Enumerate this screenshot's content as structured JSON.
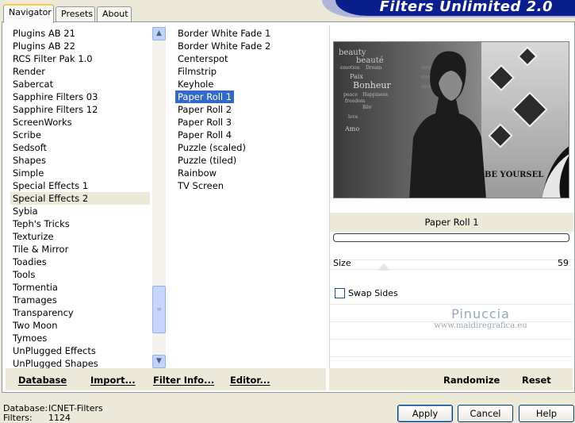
{
  "tabs": [
    {
      "label": "Navigator",
      "active": true
    },
    {
      "label": "Presets",
      "active": false
    },
    {
      "label": "About",
      "active": false
    }
  ],
  "banner": {
    "title": "Filters Unlimited 2.0"
  },
  "categories": {
    "items": [
      "Plugins AB 21",
      "Plugins AB 22",
      "RCS Filter Pak 1.0",
      "Render",
      "Sabercat",
      "Sapphire Filters 03",
      "Sapphire Filters 12",
      "ScreenWorks",
      "Scribe",
      "Sedsoft",
      "Shapes",
      "Simple",
      "Special Effects 1",
      "Special Effects 2",
      "Sybia",
      "Teph's Tricks",
      "Texturize",
      "Tile & Mirror",
      "Toadies",
      "Tools",
      "Tormentia",
      "Tramages",
      "Transparency",
      "Two Moon",
      "Tymoes",
      "UnPlugged Effects",
      "UnPlugged Shapes"
    ],
    "selected": "Special Effects 2"
  },
  "filters": {
    "items": [
      "Border White Fade 1",
      "Border White Fade 2",
      "Centerspot",
      "Filmstrip",
      "Keyhole",
      "Paper Roll 1",
      "Paper Roll 2",
      "Paper Roll 3",
      "Paper Roll 4",
      "Puzzle (scaled)",
      "Puzzle (tiled)",
      "Rainbow",
      "TV Screen"
    ],
    "selected": "Paper Roll 1"
  },
  "preview": {
    "overlay_words": [
      "beauty",
      "beauté",
      "emotion",
      "Dream",
      "Paix",
      "Bonheur",
      "peace",
      "Happiness",
      "freedom",
      "Rêv",
      "love",
      "Amo"
    ],
    "caption": "BE YOURSEL"
  },
  "filter_panel": {
    "title": "Paper Roll 1",
    "params": [
      {
        "label": "Size",
        "value": "59"
      }
    ],
    "checkbox": {
      "label": "Swap Sides",
      "checked": false
    },
    "watermark": {
      "name": "Pinuccia",
      "url": "www.maidiregrafica.eu"
    }
  },
  "left_footer": {
    "database": "Database",
    "import": "Import...",
    "filter_info": "Filter Info...",
    "editor": "Editor..."
  },
  "right_footer": {
    "randomize": "Randomize",
    "reset": "Reset"
  },
  "status": {
    "database_label": "Database:",
    "database_value": "ICNET-Filters",
    "filters_label": "Filters:",
    "filters_value": "1124"
  },
  "buttons": {
    "apply": "Apply",
    "cancel": "Cancel",
    "help": "Help"
  }
}
